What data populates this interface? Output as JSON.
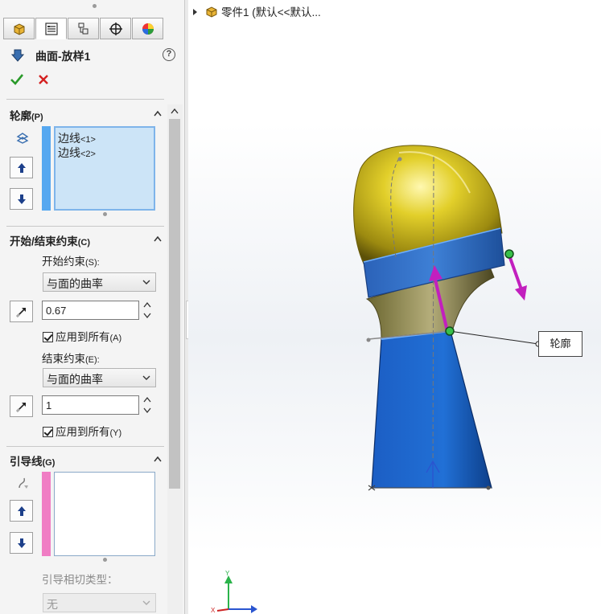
{
  "property_manager": {
    "tabs": [
      "feature-manager",
      "property-manager",
      "configuration-manager",
      "dimxpert-manager",
      "display-manager"
    ],
    "title": "曲面-放样1",
    "help": "?",
    "profiles_section": {
      "title": "轮廓",
      "key": "(P)",
      "items": [
        {
          "text": "边线",
          "suffix": "<1>"
        },
        {
          "text": "边线",
          "suffix": "<2>"
        }
      ]
    },
    "constraints_section": {
      "title": "开始/结束约束",
      "key": "(C)",
      "start_label": "开始约束",
      "start_key": "(S):",
      "start_type": "与面的曲率",
      "start_value": "0.67",
      "apply_all_1": "应用到所有",
      "apply_all_1_key": "(A)",
      "end_label": "结束约束",
      "end_key": "(E):",
      "end_type": "与面的曲率",
      "end_value": "1",
      "apply_all_2": "应用到所有",
      "apply_all_2_key": "(Y)"
    },
    "guides_section": {
      "title": "引导线",
      "key": "(G)",
      "tangent_label": "引导相切类型：",
      "tangent_value": "无"
    }
  },
  "viewport": {
    "tree_item": "零件1  (默认<<默认...",
    "callout": "轮廓",
    "triad": {
      "y_label": "Y",
      "x_label": "X"
    }
  },
  "colors": {
    "accent": "#0078d7",
    "profile_bar": "#56a8f0",
    "guide_bar": "#f07dc4",
    "yellow_surface": "#d9c520",
    "blue_surface": "#1f64c8",
    "direction_arrow": "#c21fbe"
  }
}
